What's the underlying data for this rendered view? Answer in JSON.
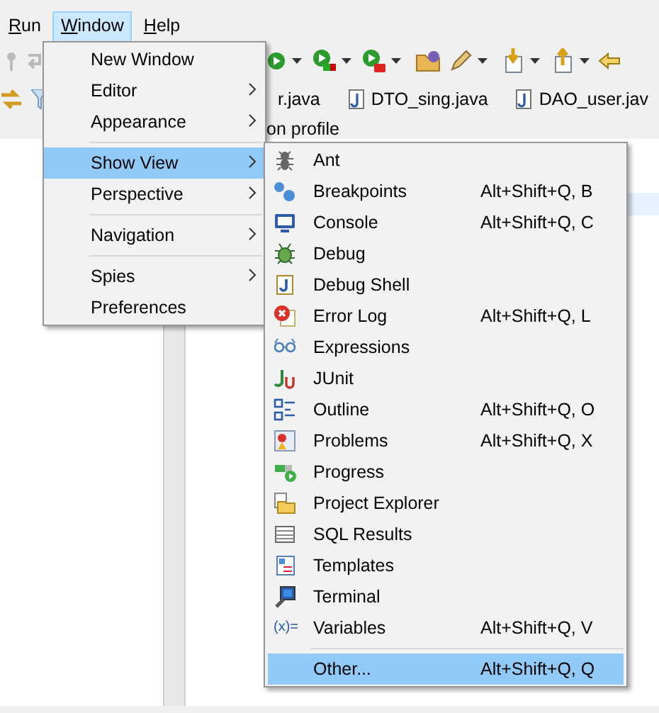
{
  "menubar": [
    {
      "label": "Run",
      "selected": false
    },
    {
      "label": "Window",
      "selected": true
    },
    {
      "label": "Help",
      "selected": false
    }
  ],
  "editor_tabs": [
    {
      "label": "r.java"
    },
    {
      "label": "DTO_sing.java"
    },
    {
      "label": "DAO_user.jav"
    }
  ],
  "view_header": "on profile",
  "window_menu": [
    {
      "kind": "item",
      "label": "New Window",
      "submenu": false,
      "selected": false
    },
    {
      "kind": "item",
      "label": "Editor",
      "submenu": true,
      "selected": false
    },
    {
      "kind": "item",
      "label": "Appearance",
      "submenu": true,
      "selected": false
    },
    {
      "kind": "separator"
    },
    {
      "kind": "item",
      "label": "Show View",
      "submenu": true,
      "selected": true
    },
    {
      "kind": "item",
      "label": "Perspective",
      "submenu": true,
      "selected": false
    },
    {
      "kind": "separator"
    },
    {
      "kind": "item",
      "label": "Navigation",
      "submenu": true,
      "selected": false
    },
    {
      "kind": "separator"
    },
    {
      "kind": "item",
      "label": "Spies",
      "submenu": true,
      "selected": false
    },
    {
      "kind": "item",
      "label": "Preferences",
      "submenu": false,
      "selected": false
    }
  ],
  "show_view_menu": [
    {
      "kind": "item",
      "label": "Ant",
      "selected": false
    },
    {
      "kind": "item",
      "label": "Breakpoints",
      "shortcut": "Alt+Shift+Q, B",
      "selected": false
    },
    {
      "kind": "item",
      "label": "Console",
      "shortcut": "Alt+Shift+Q, C",
      "selected": false
    },
    {
      "kind": "item",
      "label": "Debug",
      "selected": false
    },
    {
      "kind": "item",
      "label": "Debug Shell",
      "selected": false
    },
    {
      "kind": "item",
      "label": "Error Log",
      "shortcut": "Alt+Shift+Q, L",
      "selected": false
    },
    {
      "kind": "item",
      "label": "Expressions",
      "selected": false
    },
    {
      "kind": "item",
      "label": "JUnit",
      "selected": false
    },
    {
      "kind": "item",
      "label": "Outline",
      "shortcut": "Alt+Shift+Q, O",
      "selected": false
    },
    {
      "kind": "item",
      "label": "Problems",
      "shortcut": "Alt+Shift+Q, X",
      "selected": false
    },
    {
      "kind": "item",
      "label": "Progress",
      "selected": false
    },
    {
      "kind": "item",
      "label": "Project Explorer",
      "selected": false
    },
    {
      "kind": "item",
      "label": "SQL Results",
      "selected": false
    },
    {
      "kind": "item",
      "label": "Templates",
      "selected": false
    },
    {
      "kind": "item",
      "label": "Terminal",
      "selected": false
    },
    {
      "kind": "item",
      "icon_text": "(x)=",
      "label": "Variables",
      "shortcut": "Alt+Shift+Q, V",
      "selected": false
    },
    {
      "kind": "separator"
    },
    {
      "kind": "item",
      "label": "Other...",
      "shortcut": "Alt+Shift+Q, Q",
      "selected": true
    }
  ]
}
